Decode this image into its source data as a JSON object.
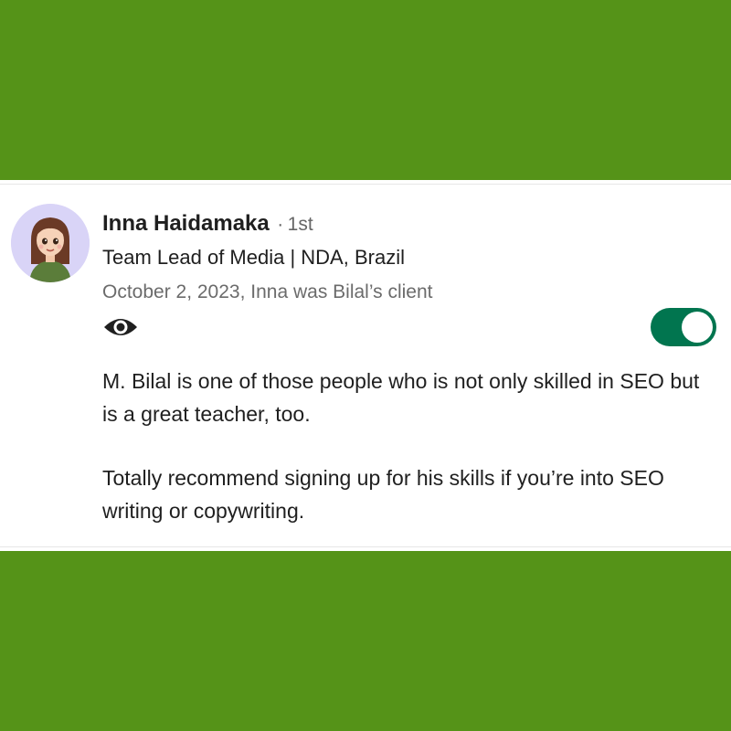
{
  "theme": {
    "background_green": "#559318",
    "toggle_on_color": "#01754f"
  },
  "recommendation": {
    "avatar_icon": "cartoon-woman-avatar",
    "name": "Inna Haidamaka",
    "separator": "·",
    "degree": "1st",
    "headline": "Team Lead of Media | NDA, Brazil",
    "meta": "October 2, 2023, Inna was Bilal’s client",
    "visibility_icon": "eye-icon",
    "toggle_state": "on",
    "paragraphs": [
      "M. Bilal is one of those people who is not only skilled in SEO but is a great teacher, too.",
      "Totally recommend signing up for his skills if you’re into SEO writing or copywriting."
    ]
  }
}
